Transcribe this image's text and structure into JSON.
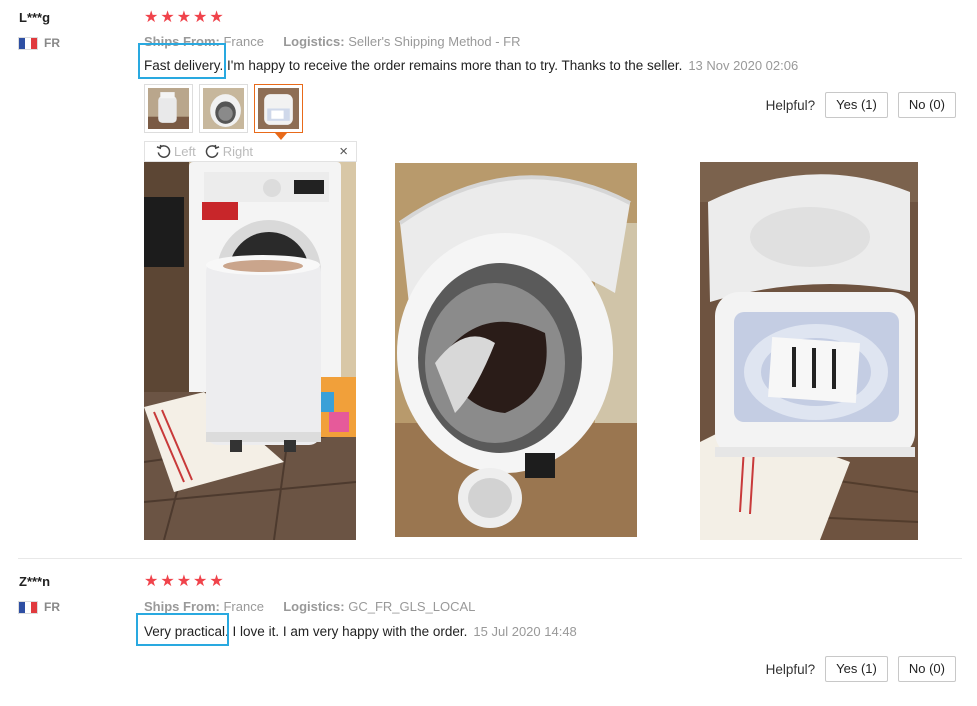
{
  "reviews": [
    {
      "user": "L***g",
      "country": "FR",
      "rating": 5,
      "ships_from_label": "Ships From:",
      "ships_from": "France",
      "logistics_label": "Logistics:",
      "logistics": "Seller's Shipping Method - FR",
      "highlight": "Fast delivery.",
      "text": " I'm happy to receive the order remains more than to try. Thanks to the seller.",
      "date": "13 Nov 2020 02:06",
      "helpful_label": "Helpful?",
      "yes_label": "Yes (1)",
      "no_label": "No (0)",
      "viewer": {
        "left_label": "Left",
        "right_label": "Right",
        "close_glyph": "×"
      }
    },
    {
      "user": "Z***n",
      "country": "FR",
      "rating": 5,
      "ships_from_label": "Ships From:",
      "ships_from": "France",
      "logistics_label": "Logistics:",
      "logistics": "GC_FR_GLS_LOCAL",
      "highlight": "Very practical.",
      "text": " I love it. I am very happy with the order.",
      "date": "15 Jul 2020 14:48",
      "helpful_label": "Helpful?",
      "yes_label": "Yes (1)",
      "no_label": "No (0)"
    }
  ],
  "colors": {
    "star": "#f0434b",
    "highlight_box": "#29a9e0",
    "active_thumb": "#e86a1a"
  }
}
